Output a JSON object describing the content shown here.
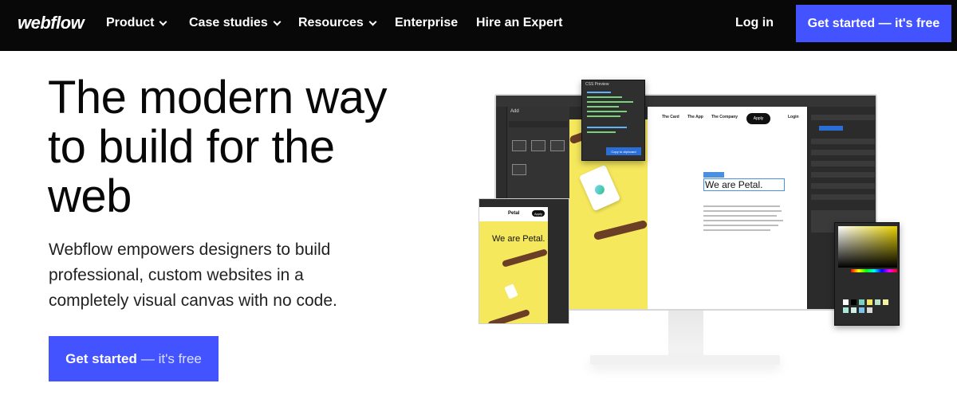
{
  "nav": {
    "logo": "webflow",
    "items": [
      {
        "label": "Product",
        "dropdown": true
      },
      {
        "label": "Case studies",
        "dropdown": true
      },
      {
        "label": "Resources",
        "dropdown": true
      },
      {
        "label": "Enterprise",
        "dropdown": false
      },
      {
        "label": "Hire an Expert",
        "dropdown": false
      }
    ],
    "login": "Log in",
    "cta": "Get started — it's free"
  },
  "hero": {
    "title": "The modern way to build for the web",
    "subtitle": "Webflow empowers designers to build professional, custom websites in a completely visual canvas with no code.",
    "cta_bold": "Get started",
    "cta_light": "— it's free"
  },
  "mockup": {
    "add_panel_title": "Add",
    "css_preview_title": "CSS Preview",
    "css_copy_button": "Copy to clipboard",
    "canvas_nav": [
      "The Card",
      "The App",
      "The Company"
    ],
    "canvas_apply": "Apply",
    "canvas_login": "Login",
    "canvas_heading": "We are Petal.",
    "mobile_brand": "Petal",
    "mobile_heading": "We are Petal."
  },
  "colors": {
    "nav_bg": "#080808",
    "accent": "#4353ff",
    "petal_yellow": "#f5e85c"
  }
}
